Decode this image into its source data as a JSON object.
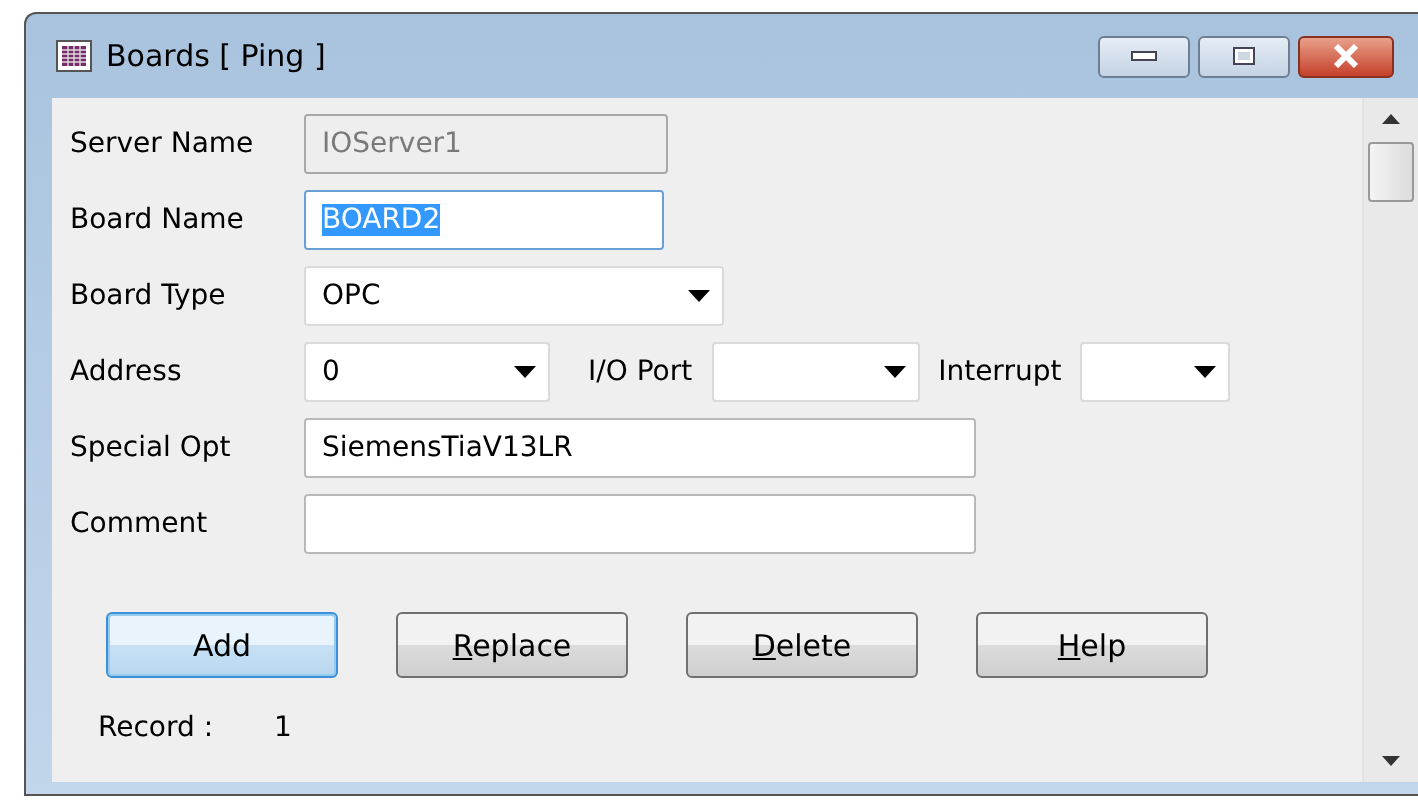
{
  "window": {
    "title": "Boards [ Ping ]"
  },
  "fields": [
    {
      "label": "Server Name",
      "kind": "text",
      "value": "IOServer1",
      "disabled": true,
      "focused": false
    },
    {
      "label": "Board Name",
      "kind": "text",
      "value": "BOARD2",
      "disabled": false,
      "focused": true
    },
    {
      "label": "Board Type",
      "kind": "dropdown",
      "value": "OPC",
      "disabled": false
    }
  ],
  "address_row": [
    {
      "label": "Address",
      "value": "0"
    },
    {
      "label": "I/O Port"
    },
    {
      "label": "Interrupt"
    }
  ],
  "text_fields": [
    {
      "label": "Special Opt",
      "value": "SiemensTiaV13LR"
    },
    {
      "label": "Comment"
    }
  ],
  "buttons": [
    {
      "label": "Add",
      "default": true
    },
    {
      "hotkey": "R",
      "label_rest": "eplace",
      "default": false
    },
    {
      "hotkey": "D",
      "label_rest": "elete",
      "default": false
    },
    {
      "hotkey": "H",
      "label_rest": "elp",
      "default": false
    }
  ],
  "record": {
    "label": "Record :",
    "value": "1"
  }
}
